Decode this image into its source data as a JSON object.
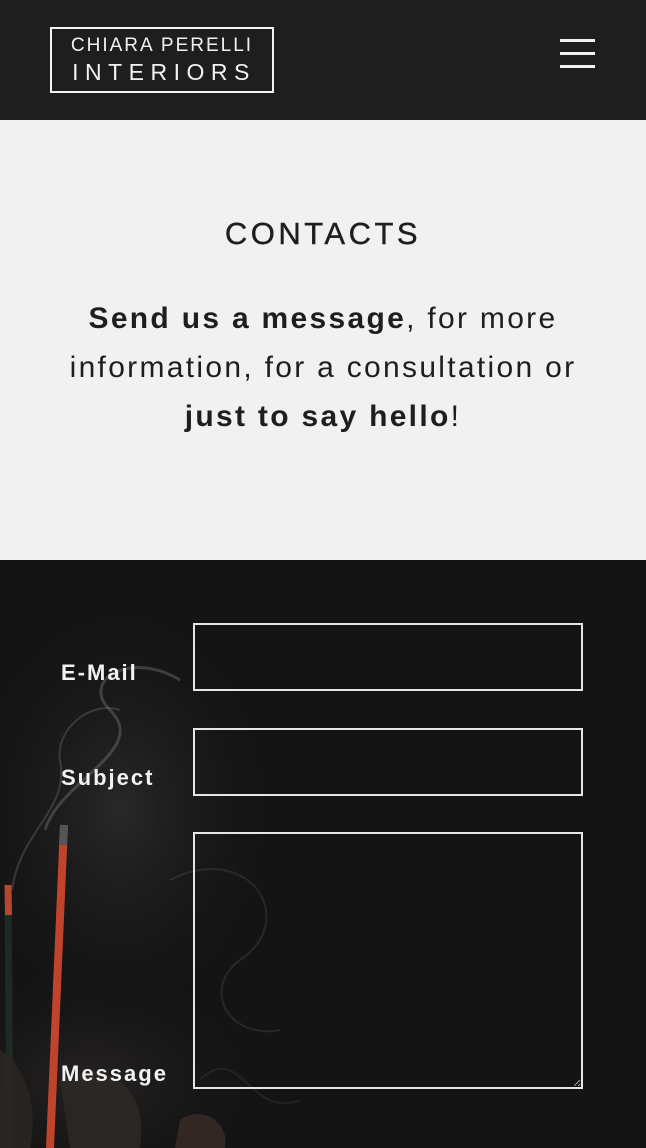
{
  "header": {
    "logo_line1": "CHIARA PERELLI",
    "logo_line2": "INTERIORS",
    "menu_icon": "hamburger-menu-icon"
  },
  "intro": {
    "heading": "CONTACTS",
    "text_bold1": "Send us a message",
    "text_mid": ", for more information, for a consultation or ",
    "text_bold2": "just to say hello",
    "text_end": "!"
  },
  "form": {
    "email_label": "E-Mail",
    "email_value": "",
    "subject_label": "Subject",
    "subject_value": "",
    "message_label": "Message",
    "message_value": ""
  },
  "colors": {
    "header_bg": "#1e1e1e",
    "intro_bg": "#f1f1f1",
    "form_bg": "#141414",
    "incense_accent": "#c0442c"
  }
}
